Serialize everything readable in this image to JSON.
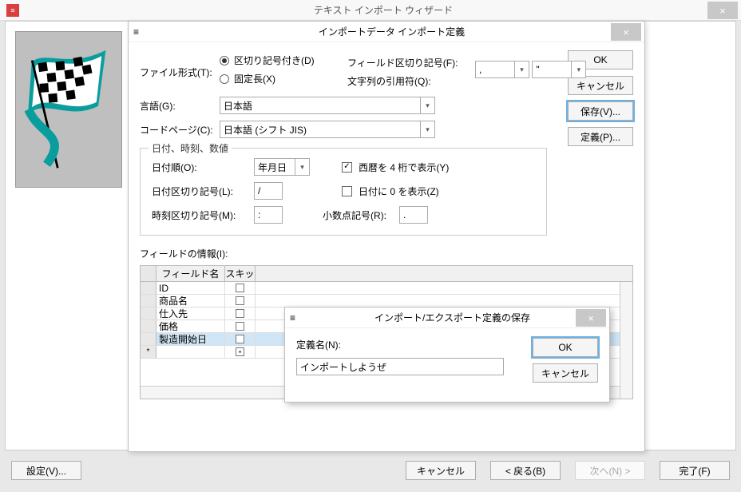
{
  "wizard_title": "テキスト インポート ウィザード",
  "settings_button": "設定(V)...",
  "cancel_button": "キャンセル",
  "back_button": "< 戻る(B)",
  "next_button": "次へ(N) >",
  "finish_button": "完了(F)",
  "import_def": {
    "title": "インポートデータ インポート定義",
    "file_format_label": "ファイル形式(T):",
    "radio_delimited": "区切り記号付き(D)",
    "radio_fixed": "固定長(X)",
    "field_delim_label": "フィールド区切り記号(F):",
    "field_delim_value": ",",
    "text_qualifier_label": "文字列の引用符(Q):",
    "text_qualifier_value": "\"",
    "language_label": "言語(G):",
    "language_value": "日本語",
    "codepage_label": "コードページ(C):",
    "codepage_value": "日本語 (シフト JIS)",
    "ok_button": "OK",
    "cancel_button": "キャンセル",
    "save_button": "保存(V)...",
    "defs_button": "定義(P)...",
    "datetime_group": "日付、時刻、数値",
    "date_order_label": "日付順(O):",
    "date_order_value": "年月日",
    "date_delim_label": "日付区切り記号(L):",
    "date_delim_value": "/",
    "time_delim_label": "時刻区切り記号(M):",
    "time_delim_value": ":",
    "four_digit_year_label": "西暦を 4 桁で表示(Y)",
    "leading_zero_label": "日付に 0 を表示(Z)",
    "decimal_label": "小数点記号(R):",
    "decimal_value": ".",
    "field_info_label": "フィールドの情報(I):",
    "grid_col_name": "フィールド名",
    "grid_col_skip": "スキッ",
    "grid_rows": [
      "ID",
      "商品名",
      "仕入先",
      "価格",
      "製造開始日"
    ]
  },
  "save_dialog": {
    "title": "インポート/エクスポート定義の保存",
    "name_label": "定義名(N):",
    "name_value": "インポートしようぜ",
    "ok_button": "OK",
    "cancel_button": "キャンセル"
  }
}
